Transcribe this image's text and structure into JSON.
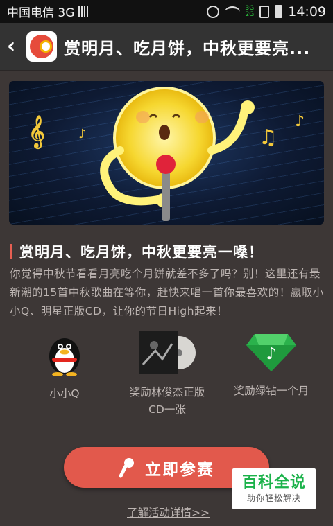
{
  "status_bar": {
    "carrier": "中国电信 3G",
    "net_top": "3G",
    "net_bottom": "2G",
    "time": "14:09"
  },
  "header": {
    "back_icon": "chevron-left-icon",
    "title": "赏明月、吃月饼，中秋更要亮..."
  },
  "article": {
    "heading": "赏明月、吃月饼，中秋更要亮一嗓！",
    "description": "你觉得中秋节看看月亮吃个月饼就差不多了吗？别！这里还有最新潮的15首中秋歌曲在等你，赶快来唱一首你最喜欢的！赢取小小Q、明星正版CD，让你的节日High起来！"
  },
  "rewards": [
    {
      "label": "小小Q",
      "icon": "penguin-icon"
    },
    {
      "label": "奖励林俊杰正版CD一张",
      "icon": "cd-album-icon"
    },
    {
      "label": "奖励绿钻一个月",
      "icon": "green-diamond-icon"
    }
  ],
  "cta": {
    "label": "立即参赛",
    "icon": "microphone-icon"
  },
  "details_link": "了解活动详情>>",
  "watermark": {
    "title": "百科全说",
    "subtitle": "助你轻松解决"
  },
  "colors": {
    "accent": "#e2594c",
    "background": "#3d3736",
    "diamond": "#2bb24c"
  }
}
